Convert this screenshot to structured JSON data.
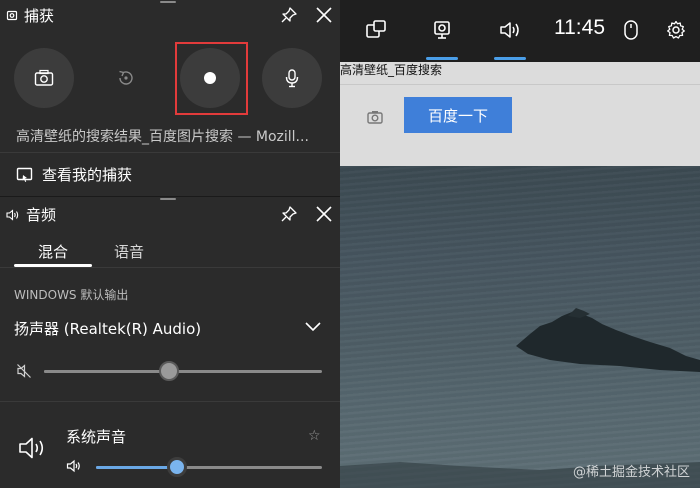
{
  "capture": {
    "title": "捕获",
    "status_text": "高清壁纸的搜索结果_百度图片搜索 — Mozill...",
    "view_captures_label": "查看我的捕获"
  },
  "audio": {
    "title": "音频",
    "tabs": [
      "混合",
      "语音"
    ],
    "active_tab": 0,
    "output_section_label": "WINDOWS 默认输出",
    "device": "扬声器 (Realtek(R) Audio)",
    "master_volume": 0.45,
    "app": {
      "name": "系统声音",
      "volume": 0.36
    }
  },
  "topbar": {
    "clock": "11:45"
  },
  "browser": {
    "page_title": "高清壁纸_百度搜索",
    "search_button": "百度一下"
  },
  "watermark": "@稀土掘金技术社区",
  "colors": {
    "accent": "#4a9ee8",
    "record_highlight": "#e23b3b",
    "panel_bg": "#2b2b2b"
  }
}
